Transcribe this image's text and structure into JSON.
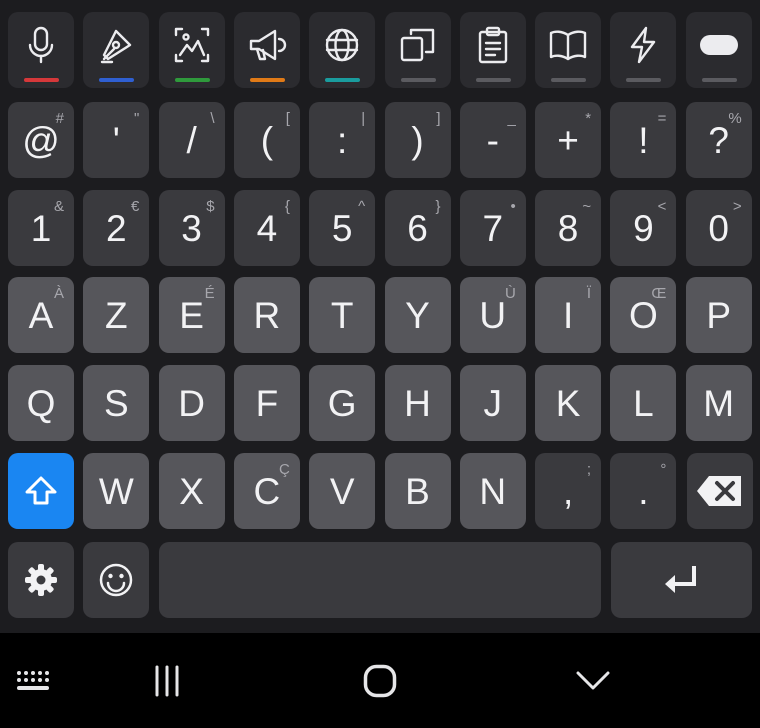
{
  "toolbar": [
    {
      "name": "voice-input-icon",
      "bar": "#d5383a"
    },
    {
      "name": "handwriting-icon",
      "bar": "#2f5fd1"
    },
    {
      "name": "image-text-icon",
      "bar": "#2f9a3c"
    },
    {
      "name": "megaphone-icon",
      "bar": "#e07a17"
    },
    {
      "name": "translate-icon",
      "bar": "#1a9c9e"
    },
    {
      "name": "copy-icon",
      "bar": "#5b5b60"
    },
    {
      "name": "clipboard-icon",
      "bar": "#5b5b60"
    },
    {
      "name": "book-icon",
      "bar": "#5b5b60"
    },
    {
      "name": "bolt-icon",
      "bar": "#5b5b60"
    },
    {
      "name": "more-pill-icon",
      "bar": "#5b5b60"
    }
  ],
  "rows": {
    "symbols": [
      {
        "main": "@",
        "sec": "#"
      },
      {
        "main": "'",
        "sec": "\""
      },
      {
        "main": "/",
        "sec": "\\"
      },
      {
        "main": "(",
        "sec": "["
      },
      {
        "main": ":",
        "sec": "|"
      },
      {
        "main": ")",
        "sec": "]"
      },
      {
        "main": "-",
        "sec": "_"
      },
      {
        "main": "+",
        "sec": "*"
      },
      {
        "main": "!",
        "sec": "="
      },
      {
        "main": "?",
        "sec": "%"
      }
    ],
    "numbers": [
      {
        "main": "1",
        "sec": "&"
      },
      {
        "main": "2",
        "sec": "€"
      },
      {
        "main": "3",
        "sec": "$"
      },
      {
        "main": "4",
        "sec": "{"
      },
      {
        "main": "5",
        "sec": "^"
      },
      {
        "main": "6",
        "sec": "}"
      },
      {
        "main": "7",
        "sec": "•"
      },
      {
        "main": "8",
        "sec": "~"
      },
      {
        "main": "9",
        "sec": "<"
      },
      {
        "main": "0",
        "sec": ">"
      }
    ],
    "azerty": [
      {
        "main": "A",
        "sec": "À"
      },
      {
        "main": "Z",
        "sec": ""
      },
      {
        "main": "E",
        "sec": "É"
      },
      {
        "main": "R",
        "sec": ""
      },
      {
        "main": "T",
        "sec": ""
      },
      {
        "main": "Y",
        "sec": ""
      },
      {
        "main": "U",
        "sec": "Ù"
      },
      {
        "main": "I",
        "sec": "Ï"
      },
      {
        "main": "O",
        "sec": "Œ"
      },
      {
        "main": "P",
        "sec": ""
      }
    ],
    "home": [
      {
        "main": "Q",
        "sec": ""
      },
      {
        "main": "S",
        "sec": ""
      },
      {
        "main": "D",
        "sec": ""
      },
      {
        "main": "F",
        "sec": ""
      },
      {
        "main": "G",
        "sec": ""
      },
      {
        "main": "H",
        "sec": ""
      },
      {
        "main": "J",
        "sec": ""
      },
      {
        "main": "K",
        "sec": ""
      },
      {
        "main": "L",
        "sec": ""
      },
      {
        "main": "M",
        "sec": ""
      }
    ],
    "bottom": [
      {
        "main": "W",
        "sec": ""
      },
      {
        "main": "X",
        "sec": ""
      },
      {
        "main": "C",
        "sec": "Ç"
      },
      {
        "main": "V",
        "sec": ""
      },
      {
        "main": "B",
        "sec": ""
      },
      {
        "main": "N",
        "sec": ""
      },
      {
        "main": ",",
        "sec": ";"
      },
      {
        "main": ".",
        "sec": "°"
      }
    ]
  },
  "colors": {
    "accent": "#1a86f2",
    "key_light": "#56565b",
    "key_dark": "#3a3a3e",
    "background": "#1c1c1f"
  },
  "icons": {
    "shift": "shift-icon",
    "backspace": "backspace-icon",
    "settings": "gear-icon",
    "emoji": "emoji-icon",
    "enter": "enter-icon",
    "nav_keyboard": "keyboard-icon",
    "nav_recents": "recents-icon",
    "nav_home": "home-icon",
    "nav_back": "chevron-down-icon"
  }
}
